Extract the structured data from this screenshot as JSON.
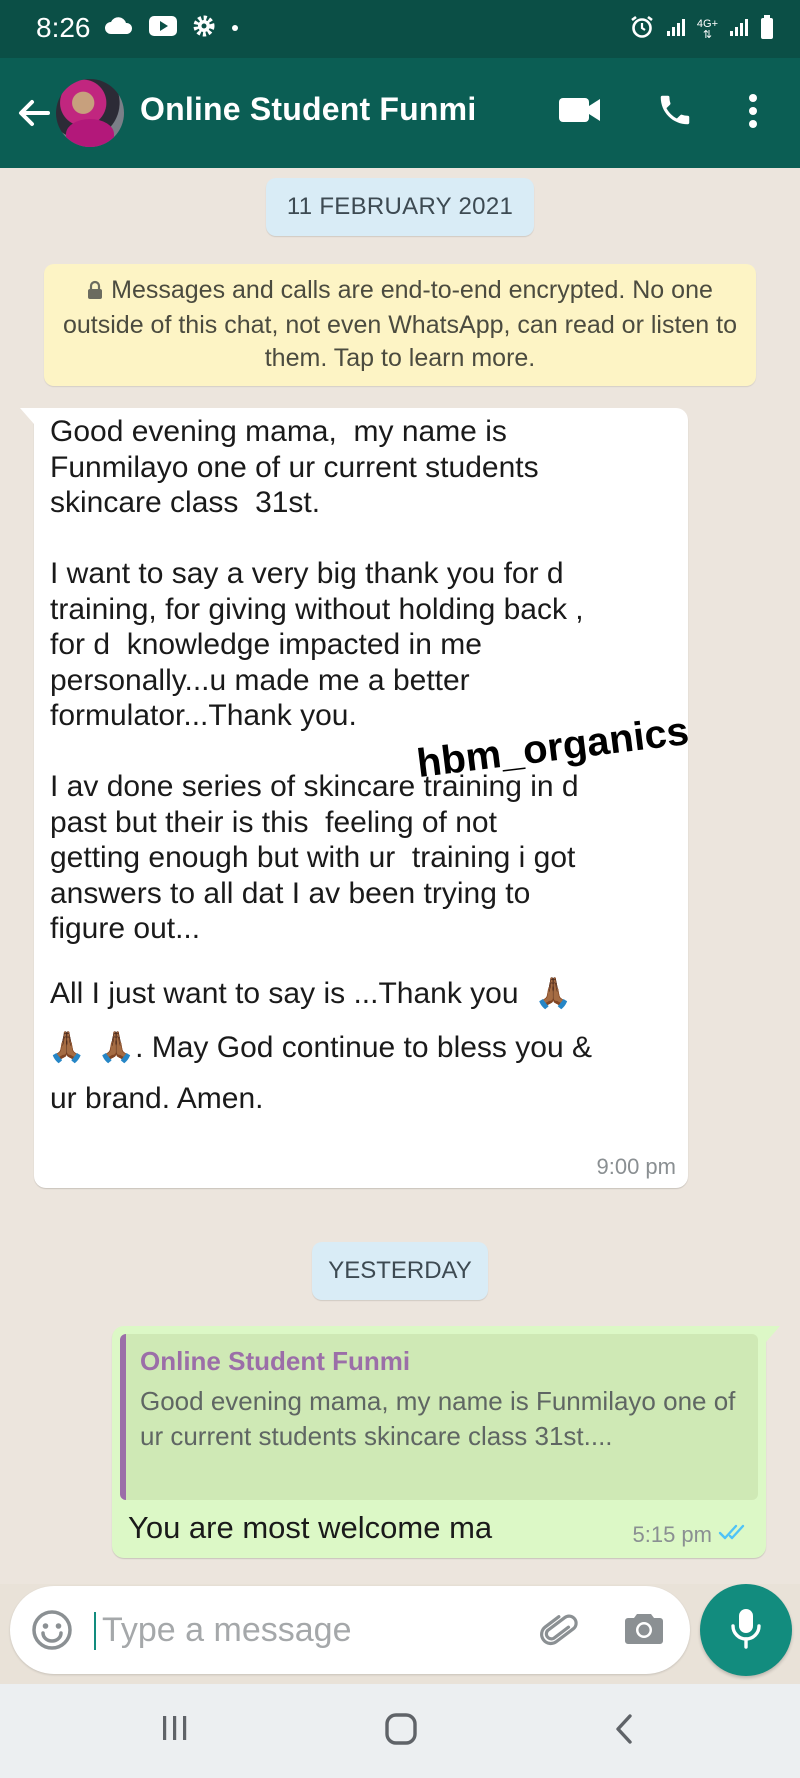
{
  "status_bar": {
    "time": "8:26",
    "network_label": "4G+"
  },
  "header": {
    "contact_name": "Online Student Funmi"
  },
  "chat": {
    "date_chip_1": "11 FEBRUARY 2021",
    "encryption_notice": "Messages and calls are end-to-end encrypted. No one outside of this chat, not even WhatsApp, can read or listen to them. Tap to learn more.",
    "incoming_message": {
      "text": "Good evening mama,  my name is\nFunmilayo one of ur current students\nskincare class  31st.\n\nI want to say a very big thank you for d\ntraining, for giving without holding back ,\nfor d  knowledge impacted in me\npersonally...u made me a better\nformulator...Thank you.\n\nI av done series of skincare training in d\npast but their is this  feeling of not\ngetting enough but with ur  training i got\nanswers to all dat I av been trying to\nfigure out...",
      "line_thank": "All I just want to say is ...Thank you",
      "line_bless": ". May God continue to bless you &",
      "line_amen": "ur brand. Amen.",
      "emoji": "🙏🏾",
      "time": "9:00 pm"
    },
    "date_chip_2": "YESTERDAY",
    "outgoing_message": {
      "quote_author": "Online Student Funmi",
      "quote_text": "Good evening mama,  my name is Funmilayo one of ur current students skincare class 31st....",
      "text": "You are most welcome  ma",
      "time": "5:15 pm",
      "status": "read"
    },
    "watermark": "hbm_organics"
  },
  "composer": {
    "placeholder": "Type a message"
  },
  "colors": {
    "header": "#0b5e54",
    "status_bar": "#0b4f46",
    "accent": "#128c7e",
    "outgoing_bubble": "#dcf8c6",
    "read_tick": "#4fc3f7"
  }
}
